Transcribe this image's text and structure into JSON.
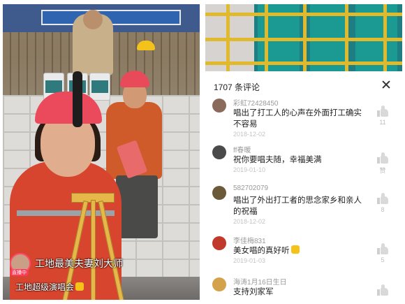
{
  "video": {
    "live_badge": "直播中",
    "title": "工地最美夫妻刘大师",
    "subtitle": "工地超级演唱会"
  },
  "comments_panel": {
    "header": "1707 条评论",
    "comments": [
      {
        "user": "彩虹72428450",
        "text": "唱出了打工人的心声在外面打工确实不容易",
        "date": "2018-12-02",
        "likes": "11",
        "avatar_color": "#8a6a5a"
      },
      {
        "user": "ff春暖",
        "text": "祝你要唱夫随，幸福美满",
        "date": "2019-01-10",
        "likes": "赞",
        "avatar_color": "#4a4a4a"
      },
      {
        "user": "582702079",
        "text": "唱出了外出打工者的思念家乡和亲人的祝福",
        "date": "2018-12-02",
        "likes": "8",
        "avatar_color": "#6a5a3a"
      },
      {
        "user": "李佳梅831",
        "text": "美女唱的真好听",
        "date": "2019-01-03",
        "likes": "5",
        "avatar_color": "#c0392b"
      },
      {
        "user": "海涛1月16日生日",
        "text": "支持刘家军",
        "date": "",
        "likes": "",
        "avatar_color": "#d4a24a"
      }
    ]
  },
  "colors": {
    "live_red": "#ff3b5c",
    "helmet_red": "#ea4a5c",
    "scaffold_yellow": "#e1b92c",
    "net_green": "#1a9a93"
  },
  "icons": [
    "close-icon",
    "like-icon",
    "thumbs-up-emoji"
  ]
}
